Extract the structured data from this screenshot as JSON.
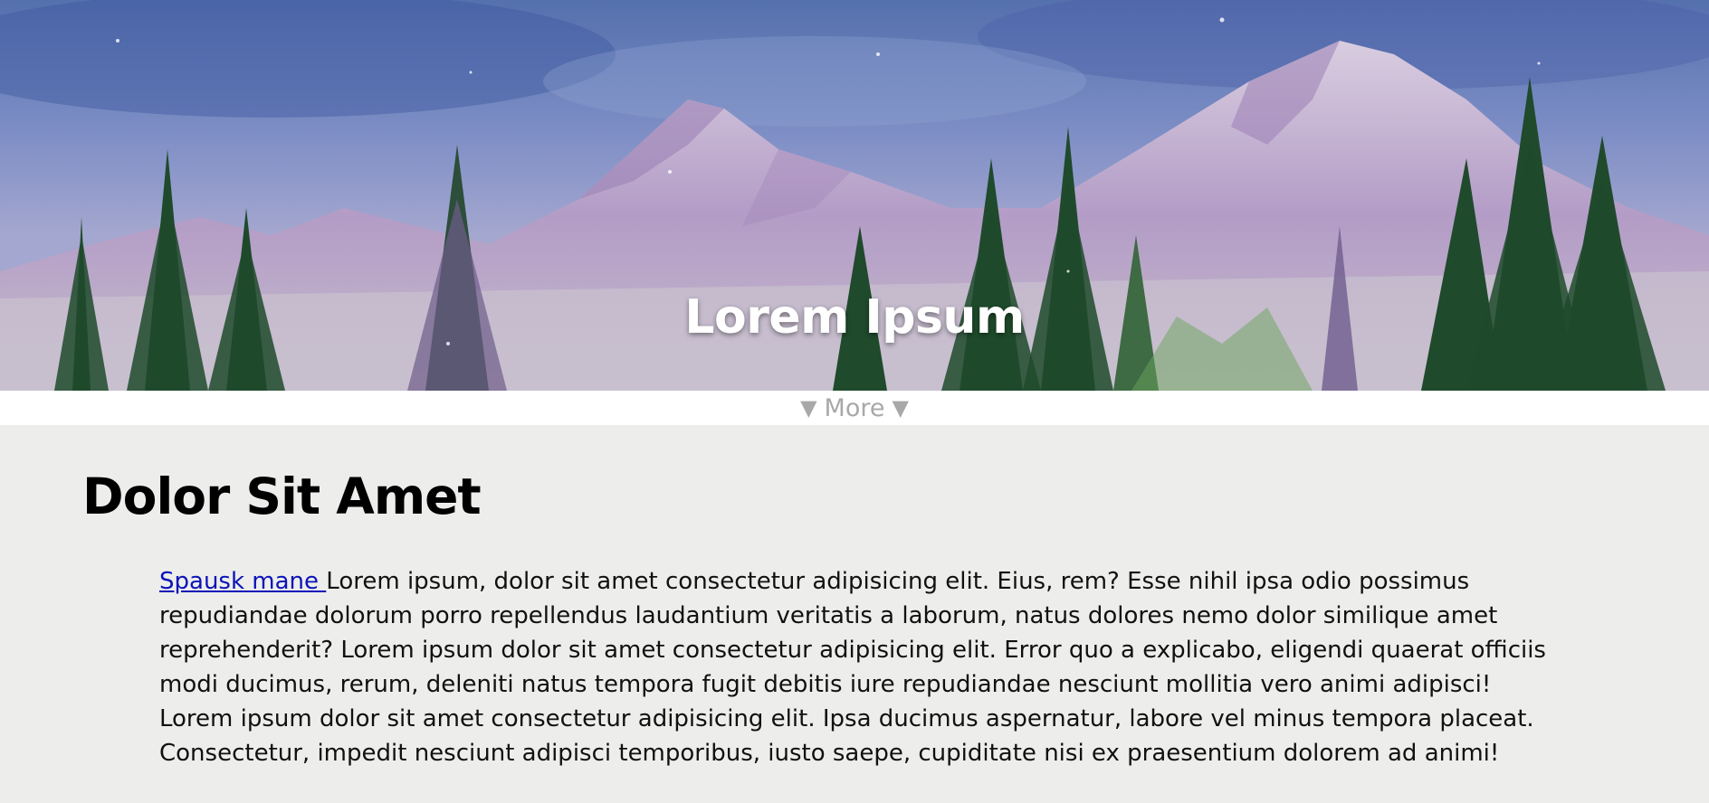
{
  "hero": {
    "title": "Lorem Ipsum"
  },
  "more": {
    "label": "More",
    "arrow_left": "▼",
    "arrow_right": "▼"
  },
  "section": {
    "title": "Dolor Sit Amet",
    "link_text": "Spausk mane ",
    "paragraph": "Lorem ipsum, dolor sit amet consectetur adipisicing elit. Eius, rem? Esse nihil ipsa odio possimus repudiandae dolorum porro repellendus laudantium veritatis a laborum, natus dolores nemo dolor similique amet reprehenderit? Lorem ipsum dolor sit amet consectetur adipisicing elit. Error quo a explicabo, eligendi quaerat officiis modi ducimus, rerum, deleniti natus tempora fugit debitis iure repudiandae nesciunt mollitia vero animi adipisci! Lorem ipsum dolor sit amet consectetur adipisicing elit. Ipsa ducimus aspernatur, labore vel minus tempora placeat. Consectetur, impedit nesciunt adipisci temporibus, iusto saepe, cupiditate nisi ex praesentium dolorem ad animi!"
  },
  "colors": {
    "page_background": "#ededeb",
    "more_bar_background": "#ffffff",
    "more_text": "#a8a8a8",
    "link": "#0b14b8"
  }
}
